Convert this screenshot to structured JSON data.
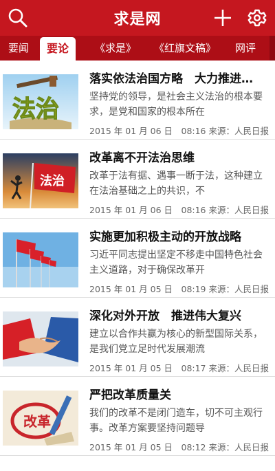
{
  "header": {
    "title": "求是网",
    "search_icon": "search-icon",
    "add_icon": "plus-icon",
    "settings_icon": "gear-icon"
  },
  "tabs": [
    {
      "label": "要闻",
      "active": false
    },
    {
      "label": "要论",
      "active": true
    },
    {
      "label": "《求是》",
      "active": false
    },
    {
      "label": "《红旗文稿》",
      "active": false
    },
    {
      "label": "网评",
      "active": false
    }
  ],
  "articles": [
    {
      "title": "落实依法治国方略　大力推进…",
      "summary": "坚持党的领导，是社会主义法治的根本要求，是党和国家的根本所在",
      "meta": "2015 年 01 月 06 日　08:16 来源：人民日报",
      "thumb_text": "法治"
    },
    {
      "title": "改革离不开法治思维",
      "summary": "改革于法有据、遇事一断于法，这种建立在法治基础之上的共识，不",
      "meta": "2015 年 01 月 06 日　08:16 来源：人民日报",
      "thumb_text": "法治"
    },
    {
      "title": "实施更加积极主动的开放战略",
      "summary": "习近平同志提出坚定不移走中国特色社会主义道路，对于确保改革开",
      "meta": "2015 年 01 月 05 日　08:19 来源：人民日报",
      "thumb_text": ""
    },
    {
      "title": "深化对外开放　推进伟大复兴",
      "summary": "建立以合作共赢为核心的新型国际关系，是我们党立足时代发展潮流",
      "meta": "2015 年 01 月 05 日　08:17 来源：人民日报",
      "thumb_text": ""
    },
    {
      "title": "严把改革质量关",
      "summary": "我们的改革不是闭门造车，切不可主观行事。改革方案要坚持问题导",
      "meta": "2015 年 01 月 05 日　08:12 来源：人民日报",
      "thumb_text": "改革"
    }
  ],
  "colors": {
    "brand_red": "#c5171f",
    "tab_bar": "#ad0e16"
  }
}
